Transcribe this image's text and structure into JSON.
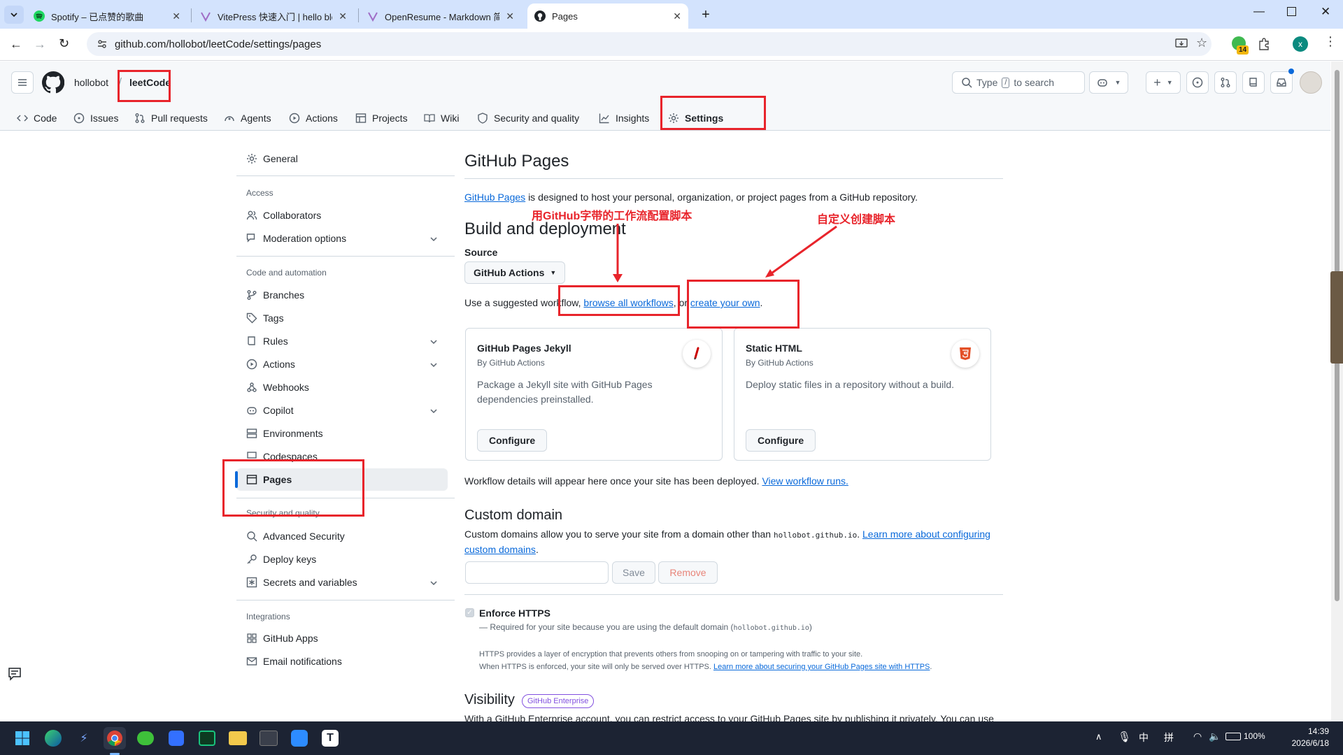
{
  "browser": {
    "tabs": [
      {
        "title": "Spotify – 已点赞的歌曲",
        "icon": "spotify-icon"
      },
      {
        "title": "VitePress 快速入门 | hello blog",
        "icon": "vitepress-icon"
      },
      {
        "title": "OpenResume - Markdown 简",
        "icon": "vitepress-icon"
      },
      {
        "title": "Pages",
        "icon": "github-icon"
      }
    ],
    "url": "github.com/hollobot/leetCode/settings/pages",
    "extension_badge": "14",
    "profile_initial": "x"
  },
  "github": {
    "owner": "hollobot",
    "repo": "leetCode",
    "search_placeholder_prefix": "Type",
    "search_key": "/",
    "search_placeholder_suffix": "to search",
    "nav": [
      {
        "label": "Code"
      },
      {
        "label": "Issues"
      },
      {
        "label": "Pull requests"
      },
      {
        "label": "Agents"
      },
      {
        "label": "Actions"
      },
      {
        "label": "Projects"
      },
      {
        "label": "Wiki"
      },
      {
        "label": "Security and quality"
      },
      {
        "label": "Insights"
      },
      {
        "label": "Settings"
      }
    ]
  },
  "sidebar": {
    "general": "General",
    "access_heading": "Access",
    "collaborators": "Collaborators",
    "moderation": "Moderation options",
    "code_heading": "Code and automation",
    "branches": "Branches",
    "tags": "Tags",
    "rules": "Rules",
    "actions": "Actions",
    "webhooks": "Webhooks",
    "copilot": "Copilot",
    "environments": "Environments",
    "codespaces": "Codespaces",
    "pages": "Pages",
    "security_heading": "Security and quality",
    "advanced_security": "Advanced Security",
    "deploy_keys": "Deploy keys",
    "secrets": "Secrets and variables",
    "integrations_heading": "Integrations",
    "github_apps": "GitHub Apps",
    "email_notifications": "Email notifications"
  },
  "main": {
    "title": "GitHub Pages",
    "intro_link": "GitHub Pages",
    "intro_rest": "is designed to host your personal, organization, or project pages from a GitHub repository.",
    "build_heading": "Build and deployment",
    "source_label": "Source",
    "source_value": "GitHub Actions",
    "suggest_prefix": "Use a suggested workflow,",
    "browse_link": "browse all workflows",
    "suggest_or": ", or",
    "create_link": "create your own",
    "suggest_end": ".",
    "cards": [
      {
        "title": "GitHub Pages Jekyll",
        "by": "By GitHub Actions",
        "desc": "Package a Jekyll site with GitHub Pages dependencies preinstalled.",
        "button": "Configure"
      },
      {
        "title": "Static HTML",
        "by": "By GitHub Actions",
        "desc": "Deploy static files in a repository without a build.",
        "button": "Configure"
      }
    ],
    "workflow_note": "Workflow details will appear here once your site has been deployed.",
    "workflow_link": "View workflow runs.",
    "custom_domain_heading": "Custom domain",
    "custom_domain_text": "Custom domains allow you to serve your site from a domain other than",
    "custom_domain_code": "hollobot.github.io",
    "custom_domain_link_1": "Learn more about configuring",
    "custom_domain_link_2": "custom domains",
    "domain_value": "",
    "save_label": "Save",
    "remove_label": "Remove",
    "https_label": "Enforce HTTPS",
    "https_note_prefix": "— Required for your site because you are using the default domain (",
    "https_note_code": "hollobot.github.io",
    "https_note_suffix": ")",
    "https_desc_1": "HTTPS provides a layer of encryption that prevents others from snooping on or tampering with traffic to your site.",
    "https_desc_2": "When HTTPS is enforced, your site will only be served over HTTPS.",
    "https_desc_link": "Learn more about securing your GitHub Pages site with HTTPS",
    "visibility_heading": "Visibility",
    "visibility_badge": "GitHub Enterprise",
    "visibility_text": "With a GitHub Enterprise account, you can restrict access to your GitHub Pages site by publishing it privately. You can use"
  },
  "annotations": {
    "left": "用GitHub字带的工作流配置脚本",
    "right": "自定义创建脚本"
  },
  "taskbar": {
    "ime_lang": "中",
    "ime_mode": "拼",
    "battery": "100%",
    "time": "14:39",
    "date": "2026/6/18"
  },
  "colors": {
    "accent": "#0969da",
    "annotation": "#e8242b",
    "selected_bar": "#0969da",
    "tabstrip": "#d3e3fd"
  }
}
